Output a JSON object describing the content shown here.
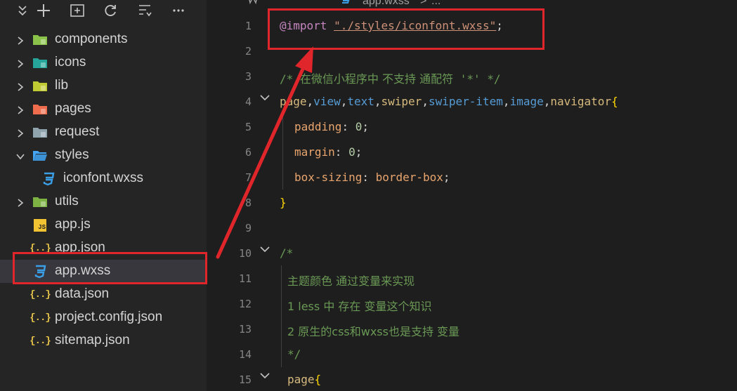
{
  "breadcrumb": {
    "file": "app.wxss",
    "separator": ">",
    "ellipsis": "..."
  },
  "toolbar_icons": [
    "collapse-icon",
    "new-file-icon",
    "new-folder-icon",
    "refresh-icon",
    "collapse-all-icon",
    "more-icon"
  ],
  "tree": [
    {
      "label": "components",
      "type": "folder",
      "expanded": false,
      "icon": "components-folder-icon"
    },
    {
      "label": "icons",
      "type": "folder",
      "expanded": false,
      "icon": "icons-folder-icon"
    },
    {
      "label": "lib",
      "type": "folder",
      "expanded": false,
      "icon": "lib-folder-icon"
    },
    {
      "label": "pages",
      "type": "folder",
      "expanded": false,
      "icon": "pages-folder-icon"
    },
    {
      "label": "request",
      "type": "folder",
      "expanded": false,
      "icon": "folder-icon"
    },
    {
      "label": "styles",
      "type": "folder",
      "expanded": true,
      "icon": "styles-folder-icon"
    },
    {
      "label": "iconfont.wxss",
      "type": "file",
      "nested": true,
      "icon": "css-file-icon"
    },
    {
      "label": "utils",
      "type": "folder",
      "expanded": false,
      "icon": "utils-folder-icon"
    },
    {
      "label": "app.js",
      "type": "file",
      "icon": "js-file-icon",
      "badge": "JS"
    },
    {
      "label": "app.json",
      "type": "file",
      "icon": "json-file-icon",
      "badge": "{..}"
    },
    {
      "label": "app.wxss",
      "type": "file",
      "icon": "css-file-icon",
      "selected": true
    },
    {
      "label": "data.json",
      "type": "file",
      "icon": "json-file-icon",
      "badge": "{..}"
    },
    {
      "label": "project.config.json",
      "type": "file",
      "icon": "json-file-icon",
      "badge": "{..}"
    },
    {
      "label": "sitemap.json",
      "type": "file",
      "icon": "json-file-icon",
      "badge": "{..}"
    }
  ],
  "code": {
    "line_numbers": [
      "1",
      "2",
      "3",
      "4",
      "5",
      "6",
      "7",
      "8",
      "9",
      "10",
      "11",
      "12",
      "13",
      "14",
      "15"
    ],
    "l1_import": "@import",
    "l1_path": "\"./styles/iconfont.wxss\"",
    "l1_semi": ";",
    "l3_comment_open": "/* ",
    "l3_comment_text": "在微信小程序中 不支持 通配符",
    "l3_comment_tail": " '*' */",
    "l4": [
      {
        "t": "page",
        "c": "sel"
      },
      {
        "t": ",",
        "c": "plain"
      },
      {
        "t": "view",
        "c": "tag"
      },
      {
        "t": ",",
        "c": "plain"
      },
      {
        "t": "text",
        "c": "tag"
      },
      {
        "t": ",",
        "c": "plain"
      },
      {
        "t": "swiper",
        "c": "sel"
      },
      {
        "t": ",",
        "c": "plain"
      },
      {
        "t": "swiper-item",
        "c": "tag"
      },
      {
        "t": ",",
        "c": "plain"
      },
      {
        "t": "image",
        "c": "tag"
      },
      {
        "t": ",",
        "c": "plain"
      },
      {
        "t": "navigator",
        "c": "sel"
      },
      {
        "t": "{",
        "c": "brace"
      }
    ],
    "l5_prop": "padding",
    "l5_val": "0",
    "l6_prop": "margin",
    "l6_val": "0",
    "l7_prop": "box-sizing",
    "l7_val": "border-box",
    "l8": "}",
    "l10": "/*",
    "l11": "主题颜色 通过变量来实现",
    "l12": "1 less 中 存在 变量这个知识",
    "l13": "2 原生的css和wxss也是支持 变量",
    "l14": "*/",
    "l15_sel": "page",
    "l15_brace": "{"
  },
  "colors": {
    "annotation": "#e0262a",
    "selection": "#37373d"
  }
}
